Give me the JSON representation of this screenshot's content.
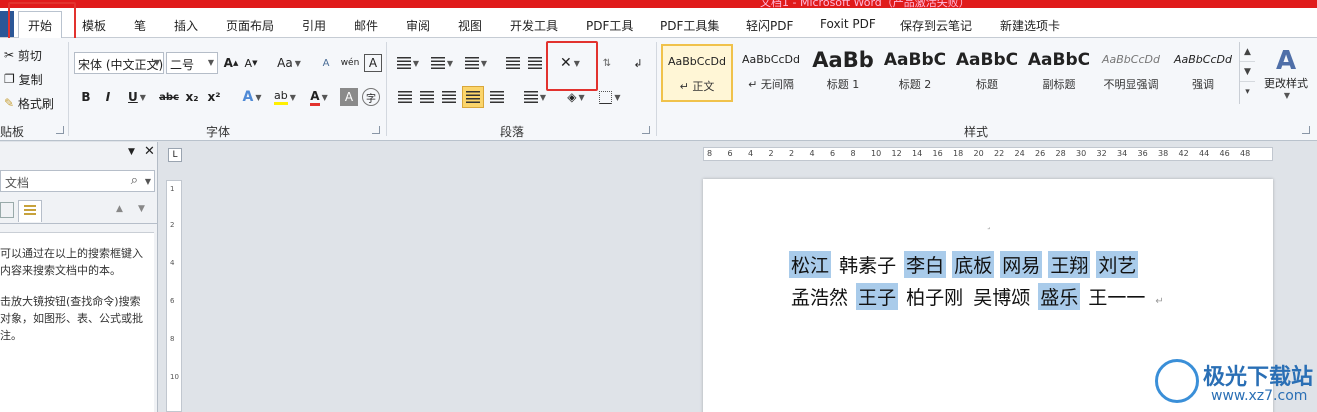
{
  "window": {
    "title": "文档1 - Microsoft Word（产品激活失败）"
  },
  "tabs": [
    "开始",
    "模板",
    "笔",
    "插入",
    "页面布局",
    "引用",
    "邮件",
    "审阅",
    "视图",
    "开发工具",
    "PDF工具",
    "PDF工具集",
    "轻闪PDF",
    "Foxit PDF",
    "保存到云笔记",
    "新建选项卡"
  ],
  "clipboard": {
    "cut": "剪切",
    "copy": "复制",
    "format_painter": "格式刷",
    "label": "贴板"
  },
  "font": {
    "name": "宋体 (中文正文)",
    "size": "二号",
    "label": "字体",
    "bold": "B",
    "italic": "I",
    "underline": "U",
    "strike": "abc",
    "sub": "x₂",
    "sup": "x²",
    "grow": "A",
    "shrink": "A",
    "case": "Aa",
    "clear": "A",
    "text_effect": "A",
    "highlight": "ab",
    "font_color": "A",
    "char_shade": "A",
    "enclose": "字",
    "phonetic": "wén",
    "border": "A"
  },
  "paragraph": {
    "label": "段落"
  },
  "styles": {
    "label": "样式",
    "items": [
      {
        "preview": "AaBbCcDd",
        "name": "↵ 正文"
      },
      {
        "preview": "AaBbCcDd",
        "name": "↵ 无间隔"
      },
      {
        "preview": "AaBb",
        "name": "标题 1"
      },
      {
        "preview": "AaBbC",
        "name": "标题 2"
      },
      {
        "preview": "AaBbC",
        "name": "标题"
      },
      {
        "preview": "AaBbC",
        "name": "副标题"
      },
      {
        "preview": "AaBbCcDd",
        "name": "不明显强调"
      },
      {
        "preview": "AaBbCcDd",
        "name": "强调"
      }
    ],
    "change": "更改样式"
  },
  "nav_pane": {
    "search_placeholder": "文档",
    "help1": "可以通过在以上的搜索框键入内容来搜索文档中的本。",
    "help2": "击放大镜按钮(查找命令)搜索对象，如图形、表、公式或批注。"
  },
  "ruler": {
    "h": [
      "8",
      "6",
      "4",
      "2",
      "2",
      "4",
      "6",
      "8",
      "10",
      "12",
      "14",
      "16",
      "18",
      "20",
      "22",
      "24",
      "26",
      "28",
      "30",
      "32",
      "34",
      "36",
      "38",
      "42",
      "44",
      "46",
      "48"
    ],
    "v": [
      "1",
      "2",
      "4",
      "6",
      "8",
      "10"
    ]
  },
  "document": {
    "line1": [
      {
        "t": "松江",
        "sel": true
      },
      {
        "t": "韩素子",
        "sel": false
      },
      {
        "t": "李白",
        "sel": true
      },
      {
        "t": "底板",
        "sel": true
      },
      {
        "t": "网易",
        "sel": true
      },
      {
        "t": "王翔",
        "sel": true
      },
      {
        "t": "刘艺",
        "sel": true
      }
    ],
    "line2": [
      {
        "t": "孟浩然",
        "sel": false
      },
      {
        "t": "王子",
        "sel": true
      },
      {
        "t": "柏子刚",
        "sel": false
      },
      {
        "t": "吴博颂",
        "sel": false
      },
      {
        "t": "盛乐",
        "sel": true
      },
      {
        "t": "王一一",
        "sel": false
      }
    ]
  },
  "watermark": {
    "name": "极光下载站",
    "url": "www.xz7.com"
  },
  "colors": {
    "accent": "#e2322e",
    "selection": "#a9cbea"
  }
}
